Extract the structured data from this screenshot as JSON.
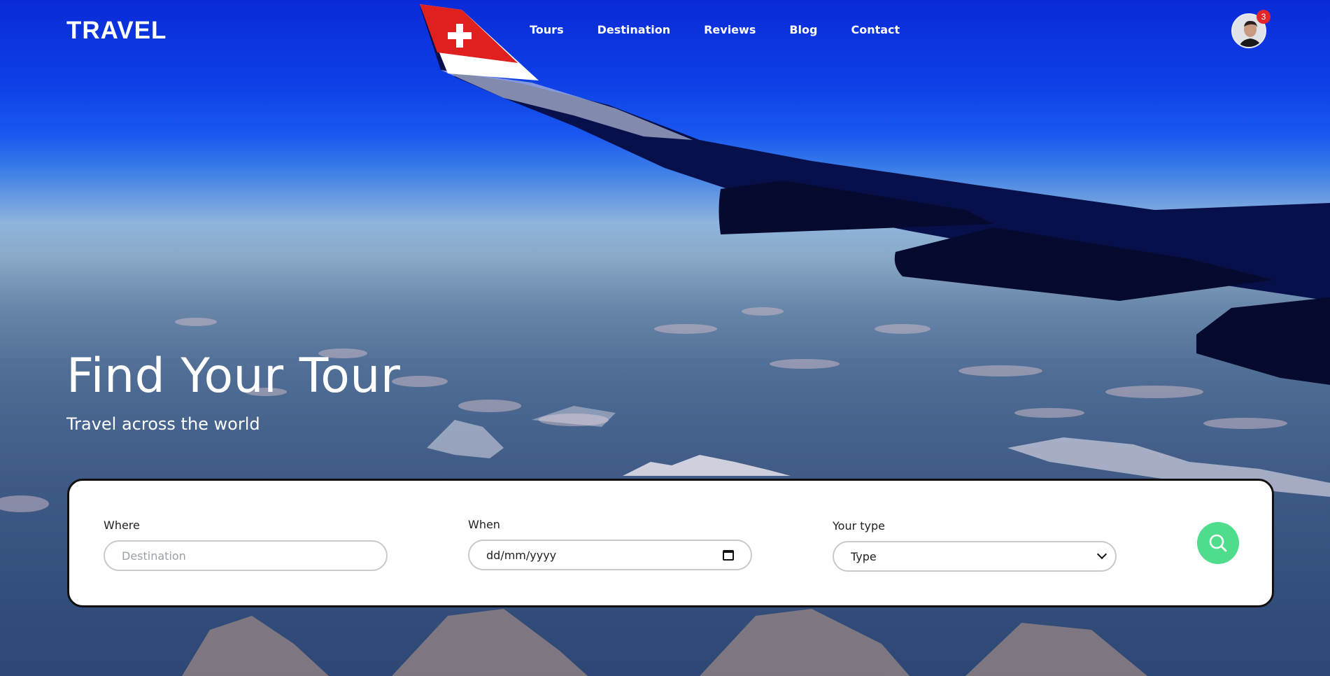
{
  "nav": {
    "logo": "TRAVEL",
    "items": [
      {
        "label": "Tours"
      },
      {
        "label": "Destination"
      },
      {
        "label": "Reviews"
      },
      {
        "label": "Blog"
      },
      {
        "label": "Contact"
      }
    ],
    "notification_count": "3"
  },
  "hero": {
    "title": "Find Your Tour",
    "subtitle": "Travel across the world"
  },
  "search": {
    "where": {
      "label": "Where",
      "placeholder": "Destination"
    },
    "when": {
      "label": "When",
      "value": "dd/mm/yyyy"
    },
    "type": {
      "label": "Your type",
      "value": "Type"
    },
    "button_icon": "search-icon"
  },
  "colors": {
    "accent": "#4fdc8c",
    "badge": "#e0262a",
    "sky": "#0d3fe6"
  }
}
